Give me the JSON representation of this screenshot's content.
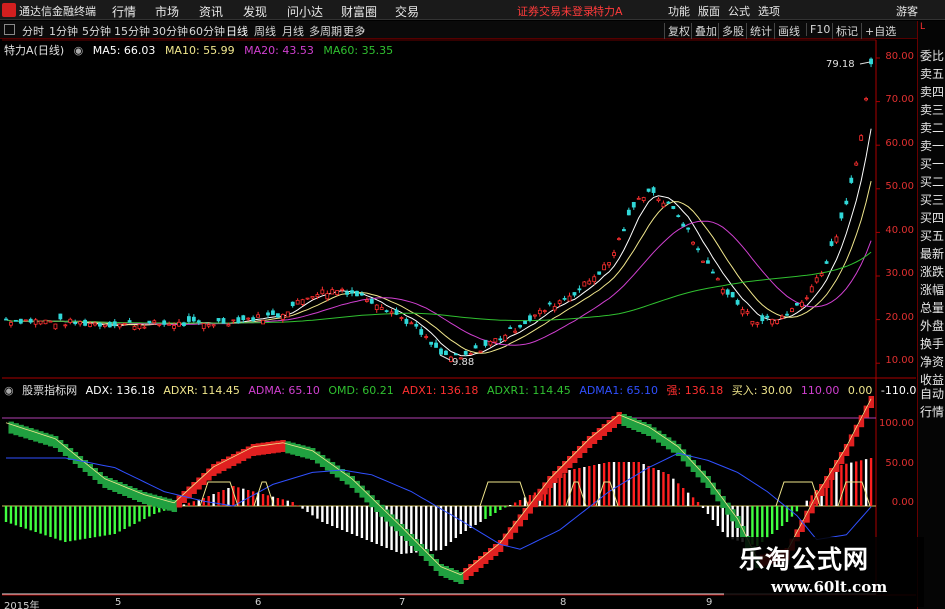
{
  "app": {
    "title": "通达信金融终端",
    "status": "证券交易未登录",
    "stock_short": "特力A",
    "user": "游客"
  },
  "menu": [
    "行情",
    "市场",
    "资讯",
    "发现",
    "问小达",
    "财富圈",
    "交易"
  ],
  "right_menu": [
    "功能",
    "版面",
    "公式",
    "选项"
  ],
  "toolbar": {
    "periods": [
      "分时",
      "1分钟",
      "5分钟",
      "15分钟",
      "30分钟",
      "60分钟",
      "日线",
      "周线",
      "月线",
      "多周期",
      "更多"
    ],
    "active": "日线",
    "right": [
      "复权",
      "叠加",
      "多股",
      "统计",
      "画线",
      "F10",
      "标记",
      "+自选"
    ]
  },
  "main": {
    "title": "特力A(日线)",
    "ma": [
      {
        "label": "MA5: 66.03",
        "color": "#ffffff"
      },
      {
        "label": "MA10: 55.99",
        "color": "#f0e68c"
      },
      {
        "label": "MA20: 43.53",
        "color": "#d040d0"
      },
      {
        "label": "MA60: 35.35",
        "color": "#30c030"
      }
    ],
    "yticks": [
      "80.00",
      "70.00",
      "60.00",
      "50.00",
      "40.00",
      "30.00",
      "20.00",
      "10.00"
    ],
    "high_label": "79.18",
    "low_label": "9.88"
  },
  "indicator": {
    "name": "股票指标网",
    "items": [
      {
        "label": "ADX: 136.18",
        "color": "#ffffff"
      },
      {
        "label": "ADXR: 114.45",
        "color": "#f0e68c"
      },
      {
        "label": "ADMA: 65.10",
        "color": "#d040d0"
      },
      {
        "label": "OMD: 60.21",
        "color": "#30c030"
      },
      {
        "label": "ADX1: 136.18",
        "color": "#ff3030"
      },
      {
        "label": "ADXR1: 114.45",
        "color": "#30c030"
      },
      {
        "label": "ADMA1: 65.10",
        "color": "#3050ff"
      },
      {
        "label": "强: 136.18",
        "color": "#ff3030"
      },
      {
        "label": "买入: 30.00",
        "color": "#f0e68c"
      },
      {
        "label": "110.00",
        "color": "#d040d0"
      },
      {
        "label": "0.00",
        "color": "#f0e68c"
      },
      {
        "label": "-110.00",
        "color": "#ffffff"
      }
    ],
    "yticks": [
      "100.00",
      "50.00",
      "0.00"
    ]
  },
  "xaxis": [
    "2015年",
    "5",
    "6",
    "7",
    "8",
    "9"
  ],
  "side": [
    "委比",
    "卖五",
    "卖四",
    "卖三",
    "卖二",
    "卖一",
    "买一",
    "买二",
    "买三",
    "买四",
    "买五",
    "最新",
    "涨跌",
    "涨幅",
    "总量",
    "外盘",
    "换手",
    "净资",
    "收益"
  ],
  "side2": [
    "自动",
    "行情"
  ],
  "watermark": {
    "title": "乐淘公式网",
    "url": "www.60lt.com"
  },
  "chart_data": {
    "type": "candlestick",
    "price_range": [
      5,
      85
    ],
    "indicator_range": [
      -110,
      140
    ]
  }
}
